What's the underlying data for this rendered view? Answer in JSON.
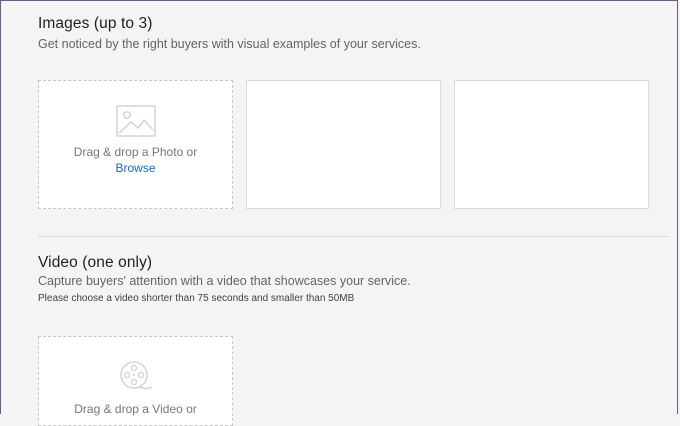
{
  "images_section": {
    "title": "Images (up to 3)",
    "description": "Get noticed by the right buyers with visual examples of your services.",
    "upload": {
      "drop_text": "Drag & drop a Photo or",
      "browse_label": "Browse",
      "icon": "image-icon"
    }
  },
  "video_section": {
    "title": "Video (one only)",
    "description": "Capture buyers' attention with a video that showcases your service.",
    "note": "Please choose a video shorter than 75 seconds and smaller than 50MB",
    "upload": {
      "drop_text": "Drag & drop a Video or",
      "icon": "film-reel-icon"
    }
  },
  "colors": {
    "link": "#1b66c9",
    "frame_border": "#6f5a86"
  }
}
